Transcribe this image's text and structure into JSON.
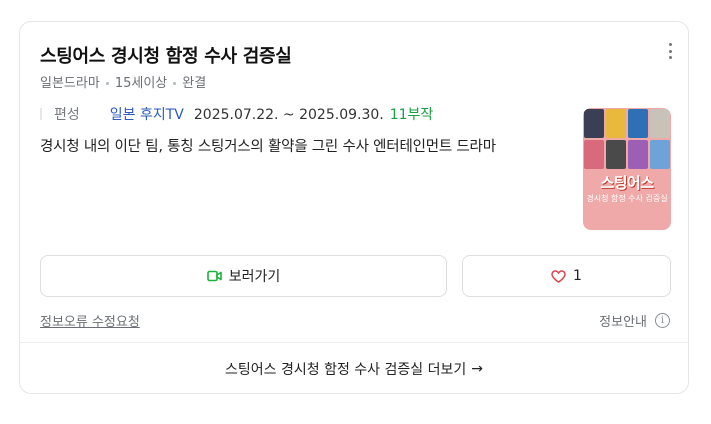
{
  "card": {
    "title": "스팅어스 경시청 함정 수사 검증실",
    "meta": [
      "일본드라마",
      "15세이상",
      "완결"
    ],
    "broadcast": {
      "label": "편성",
      "network": "일본 후지TV",
      "dates": "2025.07.22. ~ 2025.09.30.",
      "episodes": "11부작"
    },
    "description": "경시청 내의 이단 팀, 통칭 스팅거스의 활약을 그린 수사 엔터테인먼트 드라마",
    "poster": {
      "title": "스팅어스",
      "subtitle": "경시청 함정 수사 검증실",
      "bg_color": "#f0a9a9"
    },
    "buttons": {
      "watch_label": "보러가기",
      "watch_icon": "video-camera-icon",
      "like_count": "1",
      "like_icon": "heart-icon"
    },
    "report_link": "정보오류 수정요청",
    "info_label": "정보안내",
    "info_icon": "info-circle-icon",
    "footer_label": "스팅어스 경시청 함정 수사 검증실 더보기",
    "footer_icon": "arrow-right-icon"
  },
  "colors": {
    "network": "#2d5bb9",
    "episodes": "#1aa044",
    "accent_green": "#19b23c",
    "heart": "#e0404a"
  }
}
